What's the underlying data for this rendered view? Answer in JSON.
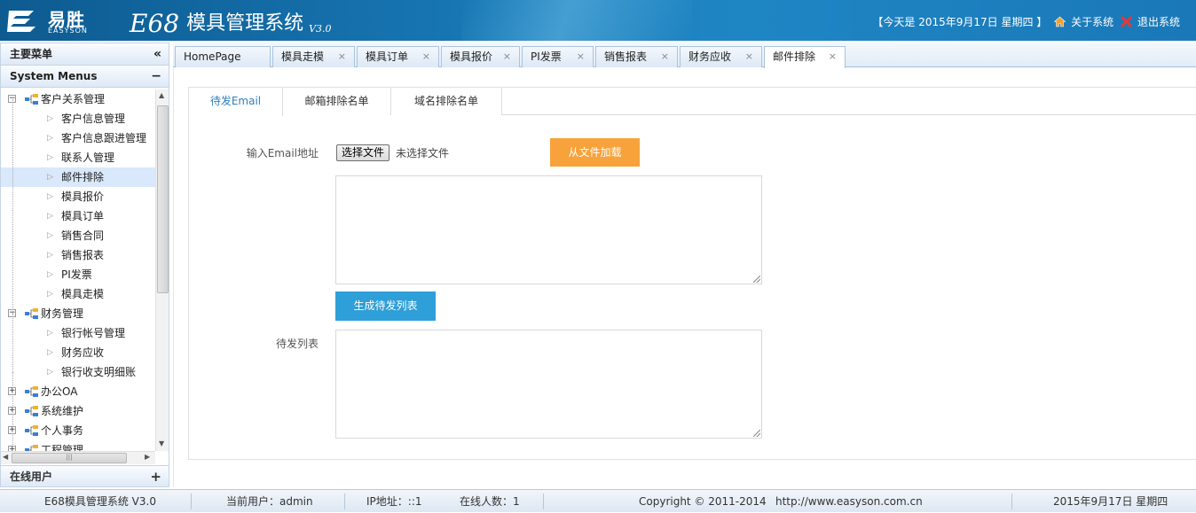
{
  "header": {
    "logo_cn": "易胜",
    "logo_en": "EASYSON",
    "app_code": "E68",
    "app_name": "模具管理系统",
    "version": "V3.0",
    "date_text": "【今天是 2015年9月17日 星期四 】",
    "about_label": "关于系统",
    "logout_label": "退出系统",
    "colors": {
      "bar": "#1877b4",
      "about_icon": "#f0a030",
      "logout_icon": "#e53935"
    }
  },
  "sidebar": {
    "title": "主要菜单",
    "collapse_icon": "double-chevron-left-icon",
    "menus_title": "System Menus",
    "menus_tool": "−",
    "tree": [
      {
        "label": "客户关系管理",
        "level": 0,
        "expanded": true
      },
      {
        "label": "客户信息管理",
        "level": 1
      },
      {
        "label": "客户信息跟进管理",
        "level": 1
      },
      {
        "label": "联系人管理",
        "level": 1
      },
      {
        "label": "邮件排除",
        "level": 1,
        "selected": true
      },
      {
        "label": "模具报价",
        "level": 1
      },
      {
        "label": "模具订单",
        "level": 1
      },
      {
        "label": "销售合同",
        "level": 1
      },
      {
        "label": "销售报表",
        "level": 1
      },
      {
        "label": "PI发票",
        "level": 1
      },
      {
        "label": "模具走模",
        "level": 1
      },
      {
        "label": "财务管理",
        "level": 0,
        "expanded": true
      },
      {
        "label": "银行帐号管理",
        "level": 1
      },
      {
        "label": "财务应收",
        "level": 1
      },
      {
        "label": "银行收支明细账",
        "level": 1
      },
      {
        "label": "办公OA",
        "level": 0,
        "expanded": false
      },
      {
        "label": "系统维护",
        "level": 0,
        "expanded": false
      },
      {
        "label": "个人事务",
        "level": 0,
        "expanded": false
      },
      {
        "label": "工程管理",
        "level": 0,
        "expanded": false
      }
    ],
    "online_title": "在线用户",
    "online_tool": "+"
  },
  "tabs": [
    {
      "label": "HomePage",
      "closable": false
    },
    {
      "label": "模具走模",
      "closable": true
    },
    {
      "label": "模具订单",
      "closable": true
    },
    {
      "label": "模具报价",
      "closable": true
    },
    {
      "label": "PI发票",
      "closable": true
    },
    {
      "label": "销售报表",
      "closable": true
    },
    {
      "label": "财务应收",
      "closable": true
    },
    {
      "label": "邮件排除",
      "closable": true,
      "active": true
    }
  ],
  "tab_close_glyph": "×",
  "content": {
    "subtabs": [
      "待发Email",
      "邮箱排除名单",
      "域名排除名单"
    ],
    "email_label": "输入Email地址",
    "file_button": "选择文件",
    "file_status": "未选择文件",
    "load_button": "从文件加载",
    "generate_button": "生成待发列表",
    "pending_label": "待发列表",
    "email_textarea_value": "",
    "pending_textarea_value": "",
    "colors": {
      "load": "#f7a23a",
      "generate": "#2e9fd8",
      "active_subtab": "#2f7fc0"
    }
  },
  "footer": {
    "system": "E68模具管理系统 V3.0",
    "user": "当前用户：admin",
    "ip": "IP地址：::1",
    "online": "在线人数：1",
    "copyright": "Copyright © 2011-2014",
    "website": "http://www.easyson.com.cn",
    "date": "2015年9月17日 星期四"
  }
}
